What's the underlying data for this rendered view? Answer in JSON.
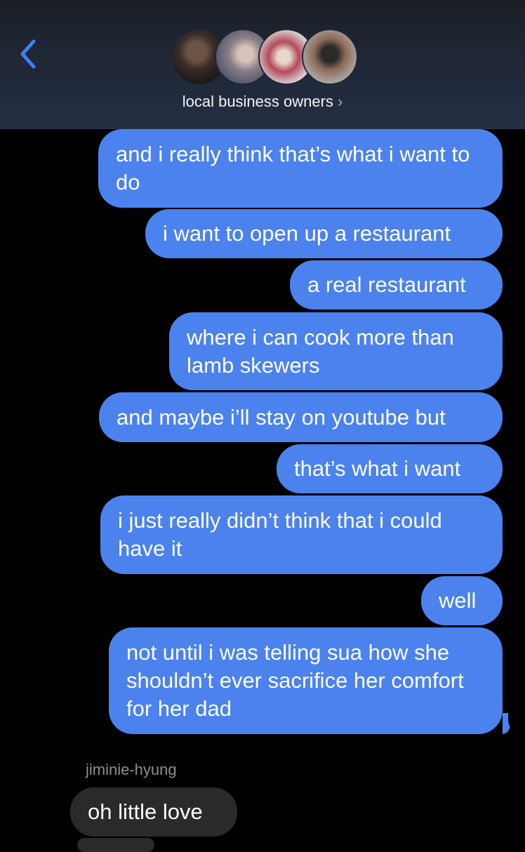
{
  "header": {
    "group_name": "local business owners",
    "chevron": "›",
    "back_icon": "chevron-left-icon",
    "accent_color": "#3b82f6"
  },
  "messages_out": [
    "and i really think that’s what i want to do",
    "i want to open up a restaurant",
    "a real restaurant",
    "where i can cook more than lamb skewers",
    "and maybe i’ll stay on youtube but",
    "that’s what i want",
    "i just really didn’t think that i could have it",
    "well",
    "not until i was telling sua how she shouldn’t ever sacrifice her comfort for her dad"
  ],
  "incoming": {
    "sender": "jiminie-hyung",
    "text": "oh little love"
  },
  "colors": {
    "outgoing_bubble": "#4b82ee",
    "incoming_bubble": "#2a2a2c",
    "background": "#000000"
  }
}
